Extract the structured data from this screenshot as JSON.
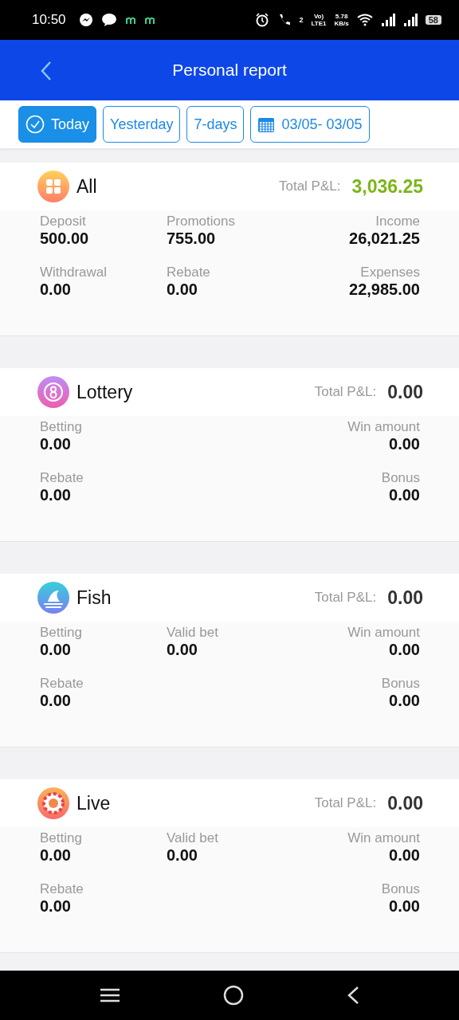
{
  "status_bar": {
    "time": "10:50",
    "call_badge": "2",
    "volte": "Vo)",
    "network": "LTE1",
    "speed": [
      "5.78",
      "KB/s"
    ],
    "battery": "58"
  },
  "header": {
    "title": "Personal report"
  },
  "filters": [
    {
      "label": "Today",
      "selected": true,
      "kind": "period"
    },
    {
      "label": "Yesterday",
      "selected": false,
      "kind": "period"
    },
    {
      "label": "7-days",
      "selected": false,
      "kind": "period"
    },
    {
      "label": "03/05- 03/05",
      "selected": false,
      "kind": "date"
    }
  ],
  "sections": [
    {
      "kind": "all",
      "title": "All",
      "total_label": "Total P&L:",
      "total": "3,036.25",
      "color": "#7cb518",
      "rows": [
        {
          "left": {
            "label": "Deposit",
            "value": "500.00"
          },
          "center": {
            "label": "Promotions",
            "value": "755.00"
          },
          "right": {
            "label": "Income",
            "value": "26,021.25"
          }
        },
        {
          "left": {
            "label": "Withdrawal",
            "value": "0.00"
          },
          "center": {
            "label": "Rebate",
            "value": "0.00"
          },
          "right": {
            "label": "Expenses",
            "value": "22,985.00"
          }
        }
      ]
    },
    {
      "kind": "lottery",
      "title": "Lottery",
      "total_label": "Total P&L:",
      "total": "0.00",
      "color": "#333333",
      "rows": [
        {
          "left": {
            "label": "Betting",
            "value": "0.00"
          },
          "right": {
            "label": "Win amount",
            "value": "0.00"
          }
        },
        {
          "left": {
            "label": "Rebate",
            "value": "0.00"
          },
          "right": {
            "label": "Bonus",
            "value": "0.00"
          }
        }
      ]
    },
    {
      "kind": "fish",
      "title": "Fish",
      "total_label": "Total P&L:",
      "total": "0.00",
      "color": "#333333",
      "rows": [
        {
          "left": {
            "label": "Betting",
            "value": "0.00"
          },
          "center": {
            "label": "Valid bet",
            "value": "0.00"
          },
          "right": {
            "label": "Win amount",
            "value": "0.00"
          }
        },
        {
          "left": {
            "label": "Rebate",
            "value": "0.00"
          },
          "right": {
            "label": "Bonus",
            "value": "0.00"
          }
        }
      ]
    },
    {
      "kind": "live",
      "title": "Live",
      "total_label": "Total P&L:",
      "total": "0.00",
      "color": "#333333",
      "rows": [
        {
          "left": {
            "label": "Betting",
            "value": "0.00"
          },
          "center": {
            "label": "Valid bet",
            "value": "0.00"
          },
          "right": {
            "label": "Win amount",
            "value": "0.00"
          }
        },
        {
          "left": {
            "label": "Rebate",
            "value": "0.00"
          },
          "right": {
            "label": "Bonus",
            "value": "0.00"
          }
        }
      ]
    }
  ]
}
